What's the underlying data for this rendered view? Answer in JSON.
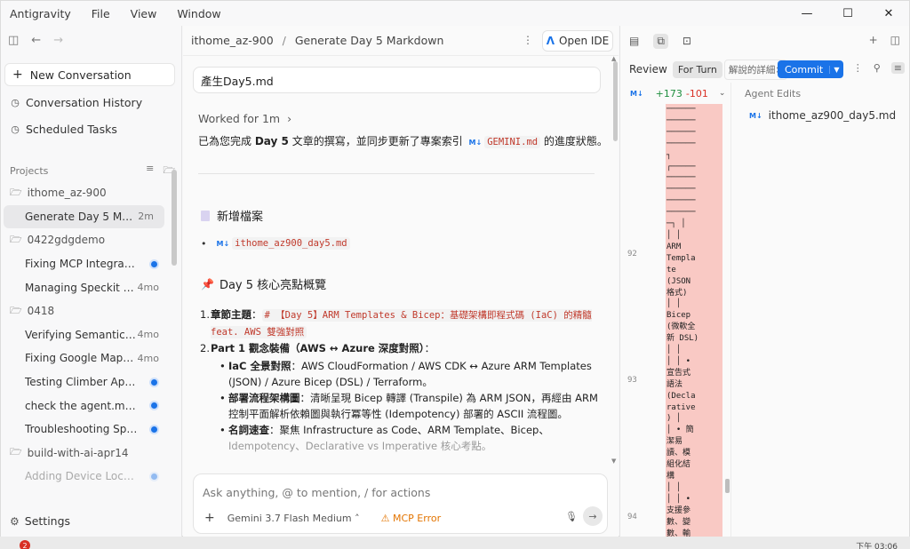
{
  "titlebar": {
    "menu": [
      "Antigravity",
      "File",
      "View",
      "Window"
    ]
  },
  "sidebar": {
    "new_conversation": "New Conversation",
    "conversation_history": "Conversation History",
    "scheduled_tasks": "Scheduled Tasks",
    "projects_label": "Projects",
    "items": [
      {
        "type": "folder",
        "label": "ithome_az-900"
      },
      {
        "type": "conv",
        "label": "Generate Day 5 Markd...",
        "meta": "2m",
        "active": true
      },
      {
        "type": "folder",
        "label": "0422gdgdemo"
      },
      {
        "type": "conv",
        "label": "Fixing MCP Integration...",
        "dot": true
      },
      {
        "type": "conv",
        "label": "Managing Speckit M...",
        "meta": "4mo"
      },
      {
        "type": "folder",
        "label": "0418"
      },
      {
        "type": "conv",
        "label": "Verifying Semantic K...",
        "meta": "4mo"
      },
      {
        "type": "conv",
        "label": "Fixing Google Maps ...",
        "meta": "4mo"
      },
      {
        "type": "conv",
        "label": "Testing Climber App Pr...",
        "dot": true
      },
      {
        "type": "conv",
        "label": "check the agent.md da...",
        "dot": true
      },
      {
        "type": "conv",
        "label": "Troubleshooting Specif...",
        "dot": true
      },
      {
        "type": "folder",
        "label": "build-with-ai-apr14"
      },
      {
        "type": "conv",
        "label": "Adding Device Locatio...",
        "dot": true,
        "faded": true
      }
    ],
    "settings": "Settings"
  },
  "conversation": {
    "breadcrumb_project": "ithome_az-900",
    "breadcrumb_title": "Generate Day 5 Markdown",
    "open_ide": "Open IDE",
    "user_message": "產生Day5.md",
    "worked_for": "Worked for 1m",
    "summary_pre": "已為您完成 ",
    "summary_bold": "Day 5",
    "summary_mid": " 文章的撰寫，並同步更新了專案索引 ",
    "summary_file": "GEMINI.md",
    "summary_post": " 的進度狀態。",
    "new_file_heading": "新增檔案",
    "new_file_name": "ithome_az900_day5.md",
    "day5_heading": "Day 5 核心亮點概覽",
    "point1_label": "章節主題",
    "point1_code": "# 【Day 5】ARM Templates & Bicep：基礎架構即程式碼 (IaC) 的精髓 feat. AWS 雙強對照",
    "point2_label": "Part 1 觀念裝備（AWS ↔ Azure 深度對照）",
    "sub1_label": "IaC 全景對照",
    "sub1_text": "AWS CloudFormation / AWS CDK ↔ Azure ARM Templates (JSON) / Azure Bicep (DSL) / Terraform。",
    "sub2_label": "部署流程架構圖",
    "sub2_text": "清晰呈現 Bicep 轉譯 (Transpile) 為 ARM JSON，再經由 ARM 控制平面解析依賴圖與執行冪等性 (Idempotency) 部署的 ASCII 流程圖。",
    "sub3_label": "名詞速查",
    "sub3_text": "聚焦 Infrastructure as Code、ARM Template、Bicep、",
    "sub3_faded": "Idempotency、Declarative vs Imperative 核心考點。",
    "composer_placeholder": "Ask anything, @ to mention, / for actions",
    "model": "Gemini 3.7 Flash Medium",
    "mcp_error": "MCP Error"
  },
  "review": {
    "review_label": "Review",
    "tab_for_turn": "For Turn",
    "tab_explain": "解說的詳細",
    "commit": "Commit",
    "diff_added": "+173",
    "diff_removed": "-101",
    "line_numbers": [
      "92",
      "93",
      "94"
    ],
    "diff_lines": "──────\n──────\n──────\n──────\n┐\n┌─────\n──────\n──────\n──────\n──────\n─┐ │\n│ │\nARM\nTempla\nte\n(JSON\n格式)\n│ │\nBicep\n(微軟全\n新 DSL)\n│ │\n│ │ •\n宣告式\n語法\n(Decla\nrative\n) │\n│ • 簡\n潔易\n讀、模\n組化結\n構\n│ │\n│ │ •\n支援參\n數、變\n數、輸",
    "agent_edits_label": "Agent Edits",
    "edited_file": "ithome_az900_day5.md"
  },
  "taskbar": {
    "notification_count": "2",
    "clock": "下午 03:06"
  }
}
